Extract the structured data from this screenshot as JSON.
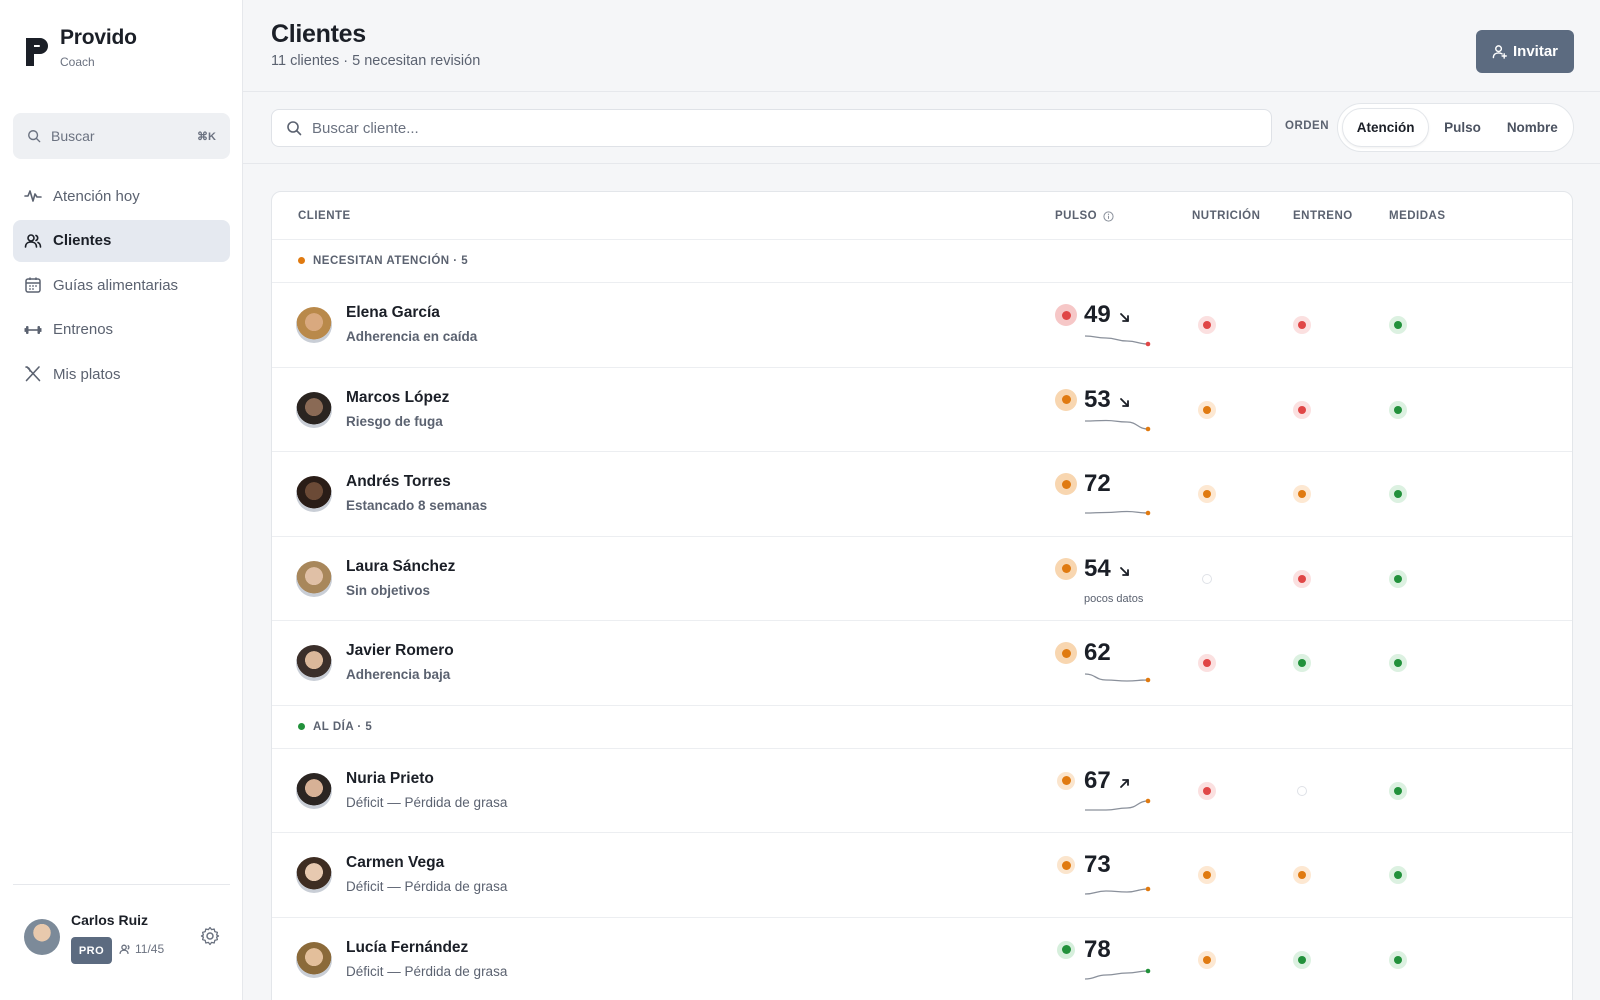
{
  "brand": {
    "name": "Provido",
    "subtitle": "Coach"
  },
  "sidebar": {
    "search": {
      "placeholder": "Buscar",
      "shortcut": "⌘K"
    },
    "items": [
      {
        "label": "Atención hoy",
        "icon": "activity-icon",
        "active": false
      },
      {
        "label": "Clientes",
        "icon": "users-icon",
        "active": true
      },
      {
        "label": "Guías alimentarias",
        "icon": "calendar-icon",
        "active": false
      },
      {
        "label": "Entrenos",
        "icon": "dumbbell-icon",
        "active": false
      },
      {
        "label": "Mis platos",
        "icon": "utensils-icon",
        "active": false
      }
    ],
    "user": {
      "name": "Carlos Ruiz",
      "plan": "PRO",
      "client_count": "11/45"
    }
  },
  "header": {
    "title": "Clientes",
    "subtitle": "11 clientes · 5 necesitan revisión",
    "invite_label": "Invitar"
  },
  "toolbar": {
    "search_placeholder": "Buscar cliente...",
    "order_label": "ORDEN",
    "order_options": [
      "Atención",
      "Pulso",
      "Nombre"
    ],
    "order_selected": "Atención"
  },
  "table": {
    "columns": {
      "client": "CLIENTE",
      "pulse": "PULSO",
      "nutrition": "NUTRICIÓN",
      "training": "ENTRENO",
      "measures": "MEDIDAS"
    },
    "groups": [
      {
        "label": "NECESITAN ATENCIÓN · 5",
        "color": "#e07a10",
        "rows": [
          {
            "name": "Elena García",
            "status": "Adherencia en caída",
            "pulse": "49",
            "pulse_level": "red",
            "trend": "down",
            "spark": [
              9,
              7,
              4,
              1
            ],
            "nutrition": "red",
            "training": "red",
            "measures": "green",
            "skin": "#d9a97f",
            "hair": "#b9894a"
          },
          {
            "name": "Marcos López",
            "status": "Riesgo de fuga",
            "pulse": "53",
            "pulse_level": "orange",
            "trend": "down",
            "spark": [
              9,
              9.5,
              8,
              1
            ],
            "nutrition": "orange",
            "training": "red",
            "measures": "green",
            "skin": "#8a6a55",
            "hair": "#2a2420"
          },
          {
            "name": "Andrés Torres",
            "status": "Estancado 8 semanas",
            "pulse": "72",
            "pulse_level": "orange",
            "trend": "",
            "spark": [
              1,
              1.5,
              2.5,
              1
            ],
            "nutrition": "orange",
            "training": "orange",
            "measures": "green",
            "skin": "#6b4a36",
            "hair": "#2a1d17"
          },
          {
            "name": "Laura Sánchez",
            "status": "Sin objetivos",
            "pulse": "54",
            "pulse_level": "orange",
            "trend": "down",
            "spark": [],
            "few_data": "pocos datos",
            "nutrition": "empty",
            "training": "red",
            "measures": "green",
            "skin": "#e0c0a6",
            "hair": "#a8875b"
          },
          {
            "name": "Javier Romero",
            "status": "Adherencia baja",
            "pulse": "62",
            "pulse_level": "orange",
            "trend": "",
            "spark": [
              9,
              3,
              2,
              3
            ],
            "nutrition": "red",
            "training": "green",
            "measures": "green",
            "skin": "#dbb89a",
            "hair": "#3b2f2a"
          }
        ]
      },
      {
        "label": "AL DÍA · 5",
        "color": "#22913b",
        "rows": [
          {
            "name": "Nuria Prieto",
            "status": "Déficit — Pérdida de grasa",
            "pulse": "67",
            "pulse_level": "orange-sm",
            "trend": "up",
            "spark": [
              1,
              1,
              3,
              10
            ],
            "nutrition": "red",
            "training": "empty",
            "measures": "green",
            "skin": "#d7b196",
            "hair": "#2b2522"
          },
          {
            "name": "Carmen Vega",
            "status": "Déficit — Pérdida de grasa",
            "pulse": "73",
            "pulse_level": "orange-sm",
            "trend": "",
            "spark": [
              1,
              4,
              3,
              6
            ],
            "nutrition": "orange",
            "training": "orange",
            "measures": "green",
            "skin": "#e7c9b0",
            "hair": "#3e2d22"
          },
          {
            "name": "Lucía Fernández",
            "status": "Déficit — Pérdida de grasa",
            "pulse": "78",
            "pulse_level": "green-sm",
            "trend": "",
            "spark": [
              1,
              5,
              7,
              9
            ],
            "nutrition": "orange",
            "training": "green",
            "measures": "green",
            "skin": "#e3bf9b",
            "hair": "#8b6a3a"
          }
        ]
      }
    ]
  },
  "colors": {
    "red": "#e04646",
    "orange": "#e07a10",
    "green": "#22913b",
    "accent": "#5c6b80"
  }
}
